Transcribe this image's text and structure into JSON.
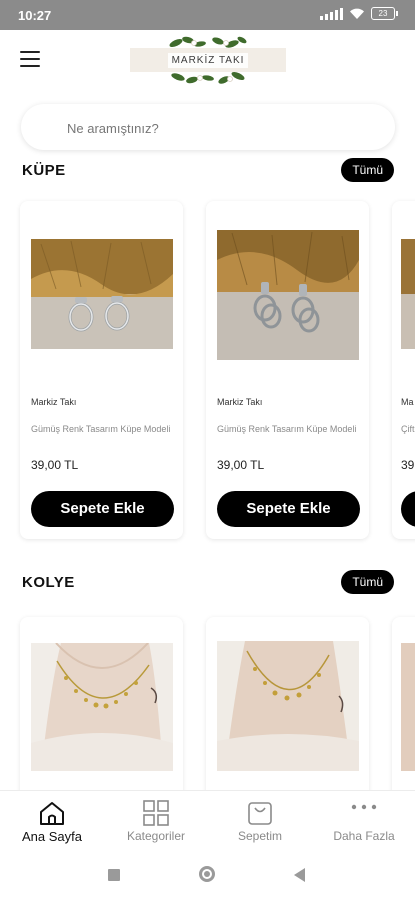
{
  "status_bar": {
    "time": "10:27",
    "battery": "23"
  },
  "header": {
    "brand": "MARKİZ TAKI"
  },
  "search": {
    "placeholder": "Ne aramıştınız?"
  },
  "sections": [
    {
      "title": "KÜPE",
      "all_label": "Tümü",
      "products": [
        {
          "brand": "Markiz Takı",
          "name": "Gümüş Renk Tasarım Küpe Modeli",
          "price": "39,00 TL",
          "button": "Sepete Ekle"
        },
        {
          "brand": "Markiz Takı",
          "name": "Gümüş Renk Tasarım Küpe Modeli",
          "price": "39,00 TL",
          "button": "Sepete Ekle"
        },
        {
          "brand": "Ma",
          "name": "Çift",
          "price": "39",
          "button": ""
        }
      ]
    },
    {
      "title": "KOLYE",
      "all_label": "Tümü",
      "products": []
    }
  ],
  "bottom_nav": [
    {
      "label": "Ana Sayfa",
      "icon": "home-icon",
      "active": true
    },
    {
      "label": "Kategoriler",
      "icon": "grid-icon",
      "active": false
    },
    {
      "label": "Sepetim",
      "icon": "shopping-bag-icon",
      "active": false
    },
    {
      "label": "Daha Fazla",
      "icon": "more-dots-icon",
      "active": false
    }
  ]
}
